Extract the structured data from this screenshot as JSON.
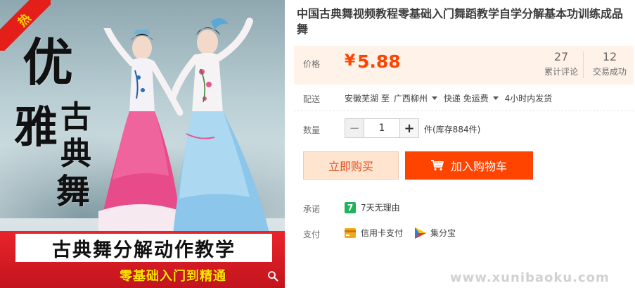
{
  "image": {
    "hot_badge": "热",
    "calligraphy": {
      "you": "优",
      "ya": "雅",
      "gu": "古",
      "dian": "典",
      "wu": "舞"
    },
    "banner_title": "古典舞分解动作教学",
    "banner_sub": "零基础入门到精通",
    "zoom_icon": "magnifier-icon"
  },
  "product": {
    "title": "中国古典舞视频教程零基础入门舞蹈教学自学分解基本功训练成品舞"
  },
  "price": {
    "label": "价格",
    "symbol": "¥",
    "value": "5.88",
    "reviews_count": "27",
    "reviews_label": "累计评论",
    "trades_count": "12",
    "trades_label": "交易成功"
  },
  "delivery": {
    "label": "配送",
    "origin": "安徽芜湖 至",
    "destination": "广西柳州",
    "shipping": "快递 免运费",
    "dispatch": "4小时内发货"
  },
  "quantity": {
    "label": "数量",
    "minus": "−",
    "value": "1",
    "plus": "+",
    "unit_stock": "件(库存884件)"
  },
  "actions": {
    "buy_now": "立即购买",
    "add_cart": "加入购物车"
  },
  "promise": {
    "label": "承诺",
    "icon_text": "7",
    "text": "7天无理由"
  },
  "payment": {
    "label": "支付",
    "credit_card": "信用卡支付",
    "jifenbao": "集分宝"
  },
  "watermark": "www.xunibaoku.com",
  "colors": {
    "accent": "#ff4400",
    "price_bg": "#fff2e8",
    "buy_now_bg": "#ffe4d0",
    "promise_green": "#1fb45c"
  }
}
